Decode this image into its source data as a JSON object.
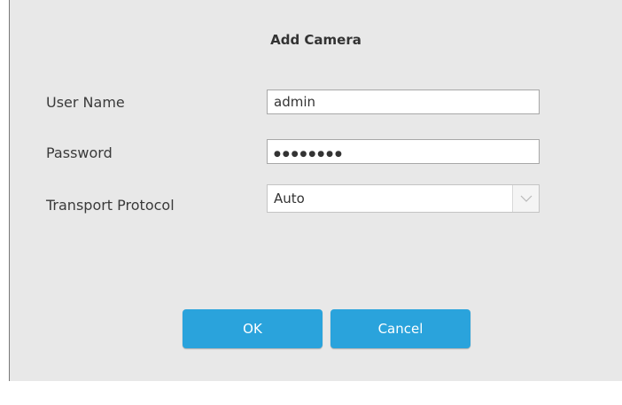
{
  "dialog": {
    "title": "Add Camera",
    "fields": {
      "username": {
        "label": "User Name",
        "value": "admin"
      },
      "password": {
        "label": "Password",
        "masked_value": "●●●●●●●●"
      },
      "transport": {
        "label": "Transport Protocol",
        "selected": "Auto"
      }
    },
    "buttons": {
      "ok": "OK",
      "cancel": "Cancel"
    },
    "colors": {
      "background": "#e8e8e8",
      "button": "#2aa3dc"
    },
    "icons": {
      "dropdown": "chevron-down-icon"
    }
  }
}
